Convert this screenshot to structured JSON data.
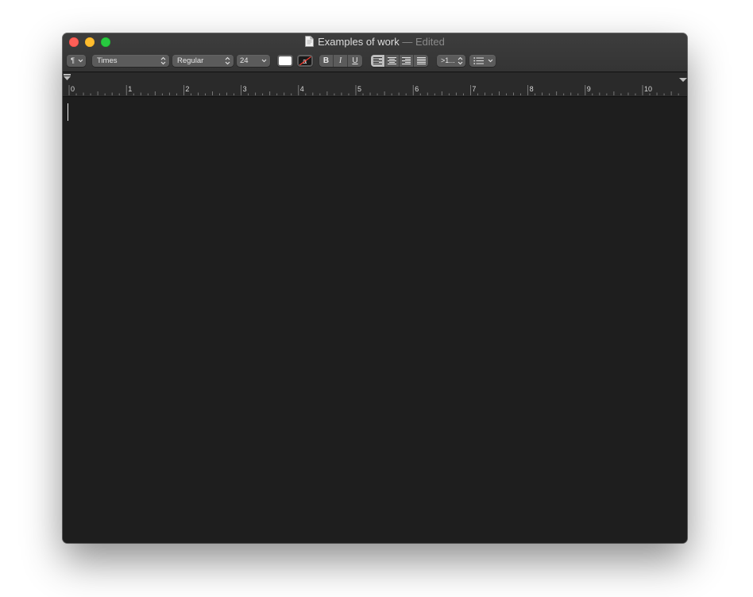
{
  "window": {
    "title": "Examples of work",
    "edited_suffix": "— Edited"
  },
  "toolbar": {
    "paragraph_styles_label": "¶",
    "font_family": "Times",
    "font_style": "Regular",
    "font_size": "24",
    "bold_label": "B",
    "italic_label": "I",
    "underline_label": "U",
    "spacing_label": ">1...",
    "list_label": "list"
  },
  "ruler": {
    "labels": [
      "0",
      "1",
      "2",
      "3",
      "4",
      "5",
      "6",
      "7",
      "8",
      "9",
      "10"
    ]
  },
  "document": {
    "text": ""
  },
  "colors": {
    "text_color": "#ffffff",
    "highlight_color": "none",
    "editor_background": "#1e1e1e"
  },
  "alignment": {
    "selected": "left"
  }
}
